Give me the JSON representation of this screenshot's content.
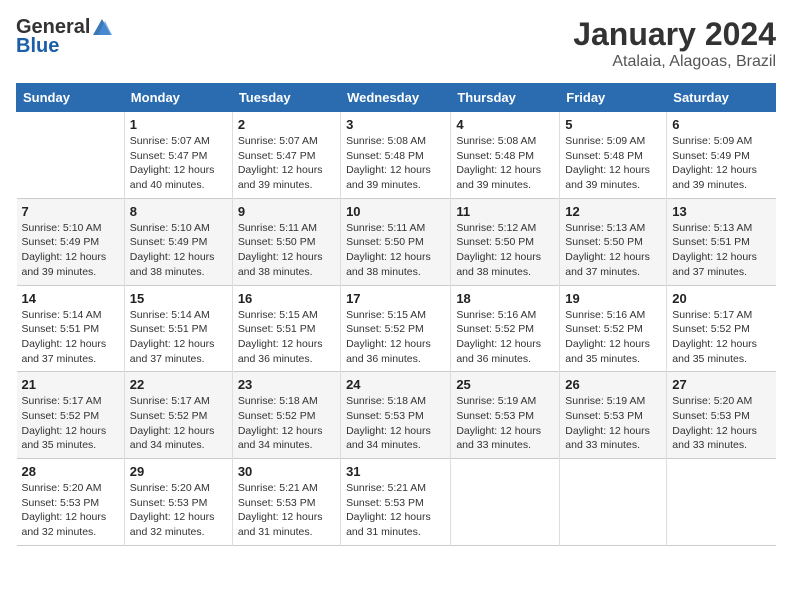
{
  "logo": {
    "general": "General",
    "blue": "Blue"
  },
  "title": {
    "month_year": "January 2024",
    "location": "Atalaia, Alagoas, Brazil"
  },
  "headers": [
    "Sunday",
    "Monday",
    "Tuesday",
    "Wednesday",
    "Thursday",
    "Friday",
    "Saturday"
  ],
  "weeks": [
    [
      {
        "day": "",
        "info": ""
      },
      {
        "day": "1",
        "info": "Sunrise: 5:07 AM\nSunset: 5:47 PM\nDaylight: 12 hours\nand 40 minutes."
      },
      {
        "day": "2",
        "info": "Sunrise: 5:07 AM\nSunset: 5:47 PM\nDaylight: 12 hours\nand 39 minutes."
      },
      {
        "day": "3",
        "info": "Sunrise: 5:08 AM\nSunset: 5:48 PM\nDaylight: 12 hours\nand 39 minutes."
      },
      {
        "day": "4",
        "info": "Sunrise: 5:08 AM\nSunset: 5:48 PM\nDaylight: 12 hours\nand 39 minutes."
      },
      {
        "day": "5",
        "info": "Sunrise: 5:09 AM\nSunset: 5:48 PM\nDaylight: 12 hours\nand 39 minutes."
      },
      {
        "day": "6",
        "info": "Sunrise: 5:09 AM\nSunset: 5:49 PM\nDaylight: 12 hours\nand 39 minutes."
      }
    ],
    [
      {
        "day": "7",
        "info": "Sunrise: 5:10 AM\nSunset: 5:49 PM\nDaylight: 12 hours\nand 39 minutes."
      },
      {
        "day": "8",
        "info": "Sunrise: 5:10 AM\nSunset: 5:49 PM\nDaylight: 12 hours\nand 38 minutes."
      },
      {
        "day": "9",
        "info": "Sunrise: 5:11 AM\nSunset: 5:50 PM\nDaylight: 12 hours\nand 38 minutes."
      },
      {
        "day": "10",
        "info": "Sunrise: 5:11 AM\nSunset: 5:50 PM\nDaylight: 12 hours\nand 38 minutes."
      },
      {
        "day": "11",
        "info": "Sunrise: 5:12 AM\nSunset: 5:50 PM\nDaylight: 12 hours\nand 38 minutes."
      },
      {
        "day": "12",
        "info": "Sunrise: 5:13 AM\nSunset: 5:50 PM\nDaylight: 12 hours\nand 37 minutes."
      },
      {
        "day": "13",
        "info": "Sunrise: 5:13 AM\nSunset: 5:51 PM\nDaylight: 12 hours\nand 37 minutes."
      }
    ],
    [
      {
        "day": "14",
        "info": "Sunrise: 5:14 AM\nSunset: 5:51 PM\nDaylight: 12 hours\nand 37 minutes."
      },
      {
        "day": "15",
        "info": "Sunrise: 5:14 AM\nSunset: 5:51 PM\nDaylight: 12 hours\nand 37 minutes."
      },
      {
        "day": "16",
        "info": "Sunrise: 5:15 AM\nSunset: 5:51 PM\nDaylight: 12 hours\nand 36 minutes."
      },
      {
        "day": "17",
        "info": "Sunrise: 5:15 AM\nSunset: 5:52 PM\nDaylight: 12 hours\nand 36 minutes."
      },
      {
        "day": "18",
        "info": "Sunrise: 5:16 AM\nSunset: 5:52 PM\nDaylight: 12 hours\nand 36 minutes."
      },
      {
        "day": "19",
        "info": "Sunrise: 5:16 AM\nSunset: 5:52 PM\nDaylight: 12 hours\nand 35 minutes."
      },
      {
        "day": "20",
        "info": "Sunrise: 5:17 AM\nSunset: 5:52 PM\nDaylight: 12 hours\nand 35 minutes."
      }
    ],
    [
      {
        "day": "21",
        "info": "Sunrise: 5:17 AM\nSunset: 5:52 PM\nDaylight: 12 hours\nand 35 minutes."
      },
      {
        "day": "22",
        "info": "Sunrise: 5:17 AM\nSunset: 5:52 PM\nDaylight: 12 hours\nand 34 minutes."
      },
      {
        "day": "23",
        "info": "Sunrise: 5:18 AM\nSunset: 5:52 PM\nDaylight: 12 hours\nand 34 minutes."
      },
      {
        "day": "24",
        "info": "Sunrise: 5:18 AM\nSunset: 5:53 PM\nDaylight: 12 hours\nand 34 minutes."
      },
      {
        "day": "25",
        "info": "Sunrise: 5:19 AM\nSunset: 5:53 PM\nDaylight: 12 hours\nand 33 minutes."
      },
      {
        "day": "26",
        "info": "Sunrise: 5:19 AM\nSunset: 5:53 PM\nDaylight: 12 hours\nand 33 minutes."
      },
      {
        "day": "27",
        "info": "Sunrise: 5:20 AM\nSunset: 5:53 PM\nDaylight: 12 hours\nand 33 minutes."
      }
    ],
    [
      {
        "day": "28",
        "info": "Sunrise: 5:20 AM\nSunset: 5:53 PM\nDaylight: 12 hours\nand 32 minutes."
      },
      {
        "day": "29",
        "info": "Sunrise: 5:20 AM\nSunset: 5:53 PM\nDaylight: 12 hours\nand 32 minutes."
      },
      {
        "day": "30",
        "info": "Sunrise: 5:21 AM\nSunset: 5:53 PM\nDaylight: 12 hours\nand 31 minutes."
      },
      {
        "day": "31",
        "info": "Sunrise: 5:21 AM\nSunset: 5:53 PM\nDaylight: 12 hours\nand 31 minutes."
      },
      {
        "day": "",
        "info": ""
      },
      {
        "day": "",
        "info": ""
      },
      {
        "day": "",
        "info": ""
      }
    ]
  ]
}
